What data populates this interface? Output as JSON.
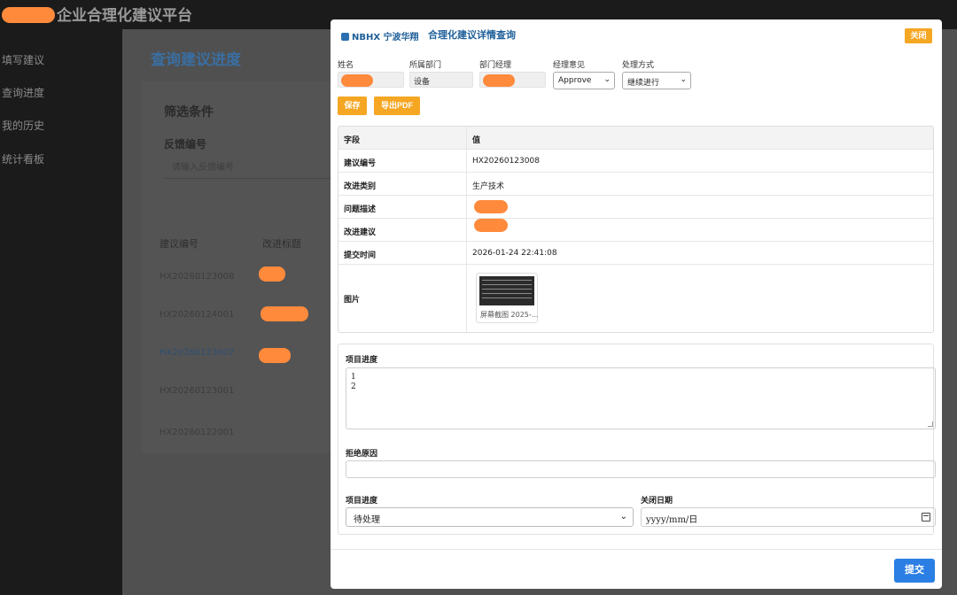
{
  "app": {
    "title": "企业合理化建议平台"
  },
  "sidebar": {
    "items": [
      {
        "label": "填写建议"
      },
      {
        "label": "查询进度"
      },
      {
        "label": "我的历史"
      },
      {
        "label": "统计看板"
      }
    ]
  },
  "page": {
    "heading": "查询建议进度",
    "filter": {
      "title": "筛选条件",
      "field_label": "反馈编号",
      "placeholder": "请输入反馈编号"
    },
    "table": {
      "headers": [
        "建议编号",
        "改进标题"
      ],
      "rows": [
        "HX20260123008",
        "HX20260124001",
        "HX20260123007",
        "HX20260123001",
        "HX20260122001"
      ]
    }
  },
  "modal": {
    "brand": "NBHX 宁波华翔",
    "title": "合理化建议详情查询",
    "close_label": "关闭",
    "fields": {
      "name_label": "姓名",
      "department_label": "所属部门",
      "department_value": "设备",
      "manager_label": "部门经理",
      "opinion_label": "经理意见",
      "opinion_value": "Approve",
      "method_label": "处理方式",
      "method_value": "继续进行"
    },
    "save_label": "保存",
    "export_label": "导出PDF",
    "detail": {
      "header": {
        "key": "字段",
        "value": "值"
      },
      "rows": [
        {
          "key": "建议编号",
          "value": "HX20260123008"
        },
        {
          "key": "改进类别",
          "value": "生产技术"
        },
        {
          "key": "问题描述",
          "value": ""
        },
        {
          "key": "改进建议",
          "value": ""
        },
        {
          "key": "提交时间",
          "value": "2026-01-24 22:41:08"
        },
        {
          "key": "图片",
          "value": ""
        }
      ],
      "image_caption": "屏幕截图 2025-..."
    },
    "progress_label": "项目进度",
    "progress_text": [
      "1",
      "2"
    ],
    "reject_label": "拒绝原因",
    "status_label": "项目进度",
    "status_value": "待处理",
    "close_date_label": "关闭日期",
    "close_date_placeholder": "yyyy/mm/日",
    "submit_label": "提交"
  },
  "colors": {
    "accent_orange": "#f5a623",
    "primary_blue": "#2a7ee4",
    "brand_blue": "#1f5f99",
    "redaction": "#ff8a3c"
  }
}
